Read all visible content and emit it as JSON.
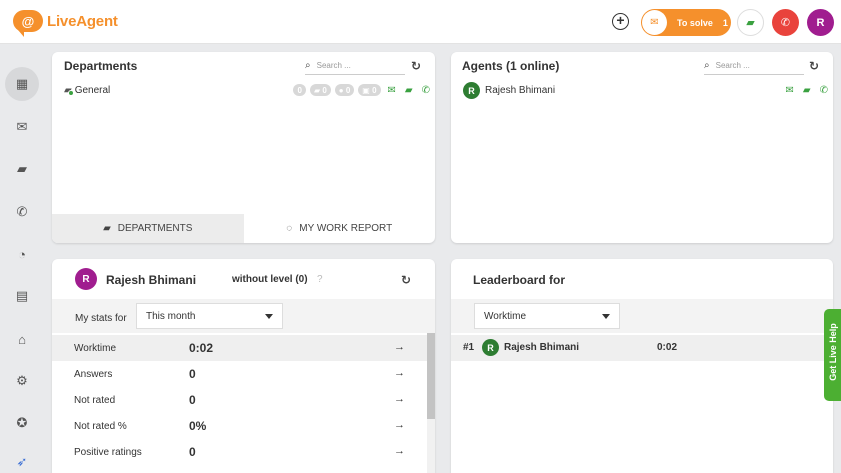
{
  "app": {
    "logo_letter": "@",
    "logo_text": "LiveAgent"
  },
  "header": {
    "plus_glyph": "+",
    "to_solve_label": "To solve",
    "to_solve_count": "1",
    "user_initial": "R"
  },
  "sidebar": {
    "items": [
      {
        "name": "dashboard",
        "glyph": "▦"
      },
      {
        "name": "tickets",
        "glyph": "✉"
      },
      {
        "name": "chats",
        "glyph": "▰"
      },
      {
        "name": "calls",
        "glyph": "✆"
      },
      {
        "name": "reports",
        "glyph": "◔"
      },
      {
        "name": "contacts",
        "glyph": "▤"
      },
      {
        "name": "knowledgebase",
        "glyph": "⌂"
      },
      {
        "name": "settings",
        "glyph": "⚙"
      },
      {
        "name": "plugins",
        "glyph": "✪"
      },
      {
        "name": "getting-started",
        "glyph": "➶"
      }
    ]
  },
  "departments": {
    "title": "Departments",
    "search_placeholder": "Search ...",
    "rows": [
      {
        "name": "General",
        "counts": [
          "0",
          "0",
          "0",
          "0"
        ]
      }
    ],
    "tabs": [
      "DEPARTMENTS",
      "MY WORK REPORT"
    ]
  },
  "agents": {
    "title": "Agents (1 online)",
    "search_placeholder": "Search ...",
    "rows": [
      {
        "initial": "R",
        "name": "Rajesh Bhimani"
      }
    ]
  },
  "stats": {
    "user_initial": "R",
    "user_name": "Rajesh Bhimani",
    "level": "without level (0)",
    "help_glyph": "?",
    "filter_label": "My stats for",
    "period": "This month",
    "rows": [
      {
        "label": "Worktime",
        "value": "0:02"
      },
      {
        "label": "Answers",
        "value": "0"
      },
      {
        "label": "Not rated",
        "value": "0"
      },
      {
        "label": "Not rated %",
        "value": "0%"
      },
      {
        "label": "Positive ratings",
        "value": "0"
      }
    ]
  },
  "leaderboard": {
    "title": "Leaderboard for",
    "metric": "Worktime",
    "rows": [
      {
        "rank": "#1",
        "initial": "R",
        "name": "Rajesh Bhimani",
        "value": "0:02"
      }
    ]
  },
  "live_help": {
    "label": "Get Live Help"
  },
  "colors": {
    "accent": "#f5902c",
    "green": "#3aa140",
    "red": "#e9433c",
    "purple": "#a01d8f"
  }
}
